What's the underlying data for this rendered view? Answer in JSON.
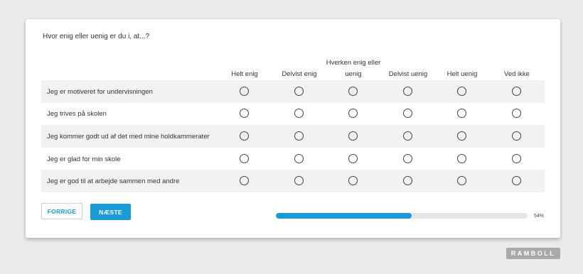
{
  "survey": {
    "question": "Hvor enig eller uenig er du i, at...?",
    "columns": [
      "Helt enig",
      "Delvist enig",
      "Hverken enig eller uenig",
      "Delvist uenig",
      "Helt uenig",
      "Ved ikke"
    ],
    "rows": [
      "Jeg er motiveret for undervisningen",
      "Jeg trives på skolen",
      "Jeg kommer godt ud af det med mine holdkammerater",
      "Jeg er glad for min skole",
      "Jeg er god til at arbejde sammen med andre"
    ]
  },
  "nav": {
    "prev_label": "FORRIGE",
    "next_label": "NÆSTE"
  },
  "progress": {
    "value_percent": 54,
    "label": "54%"
  },
  "brand": {
    "logo_text": "RAMBOLL",
    "accent_color": "#1a9ad6"
  }
}
